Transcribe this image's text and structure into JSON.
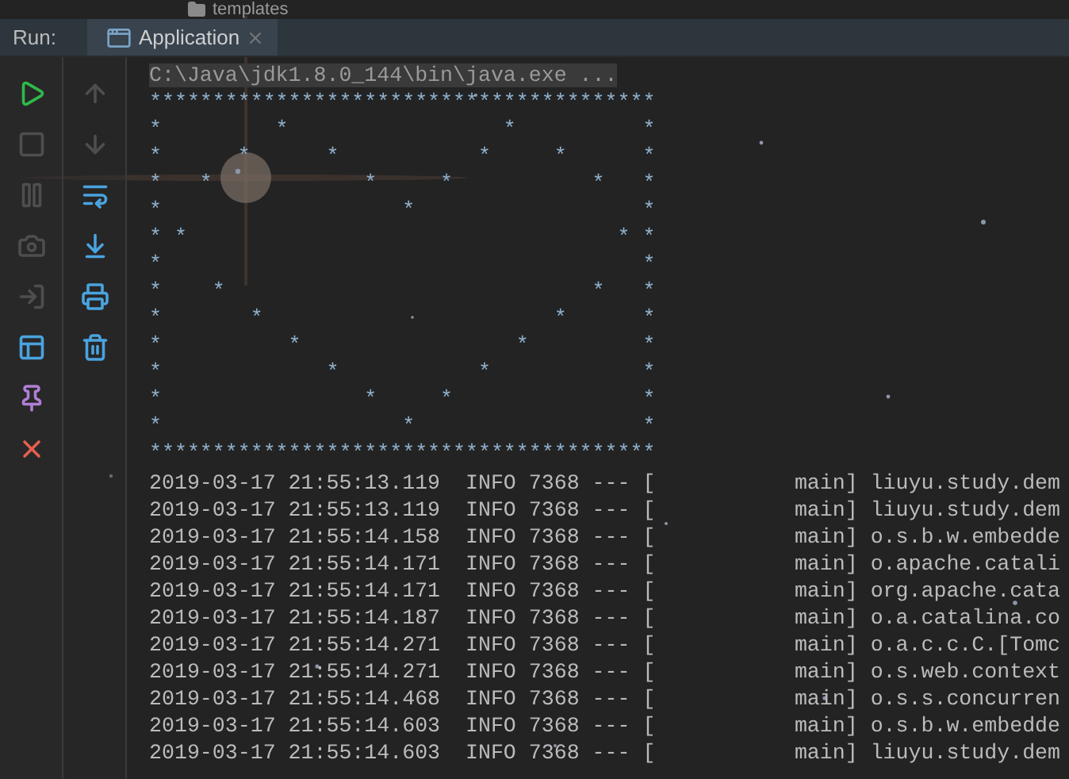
{
  "project_tree": {
    "folder": "templates"
  },
  "run_panel": {
    "label": "Run:",
    "tabs": [
      {
        "label": "Application",
        "selected": true
      }
    ]
  },
  "toolbar_left": [
    {
      "disabled": false
    },
    {
      "disabled": true
    },
    {
      "disabled": true
    },
    {
      "disabled": true
    },
    {
      "disabled": true
    },
    {
      "disabled": false
    },
    {
      "disabled": false
    },
    {
      "disabled": false
    }
  ],
  "toolbar_right": [
    {
      "disabled": true
    },
    {
      "disabled": true
    },
    {
      "disabled": false
    },
    {
      "disabled": false
    },
    {
      "disabled": false
    },
    {
      "disabled": false
    }
  ],
  "console": {
    "command": "C:\\Java\\jdk1.8.0_144\\bin\\java.exe ...",
    "art": "****************************************\n*         *                 *          *\n*      *      *           *     *      *\n*   *            *     *           *   *\n*                   *                  *\n* *                                  * *\n*                                      *\n*    *                             *   *\n*       *                       *      *\n*          *                 *         *\n*             *           *            *\n*                *     *               *\n*                   *                  *\n****************************************",
    "log": [
      "2019-03-17 21:55:13.119  INFO 7368 --- [           main] liuyu.study.dem",
      "2019-03-17 21:55:13.119  INFO 7368 --- [           main] liuyu.study.dem",
      "2019-03-17 21:55:14.158  INFO 7368 --- [           main] o.s.b.w.embedde",
      "2019-03-17 21:55:14.171  INFO 7368 --- [           main] o.apache.catali",
      "2019-03-17 21:55:14.171  INFO 7368 --- [           main] org.apache.cata",
      "2019-03-17 21:55:14.187  INFO 7368 --- [           main] o.a.catalina.co",
      "2019-03-17 21:55:14.271  INFO 7368 --- [           main] o.a.c.c.C.[Tomc",
      "2019-03-17 21:55:14.271  INFO 7368 --- [           main] o.s.web.context",
      "2019-03-17 21:55:14.468  INFO 7368 --- [           main] o.s.s.concurren",
      "2019-03-17 21:55:14.603  INFO 7368 --- [           main] o.s.b.w.embedde",
      "2019-03-17 21:55:14.603  INFO 7368 --- [           main] liuyu.study.dem"
    ]
  }
}
